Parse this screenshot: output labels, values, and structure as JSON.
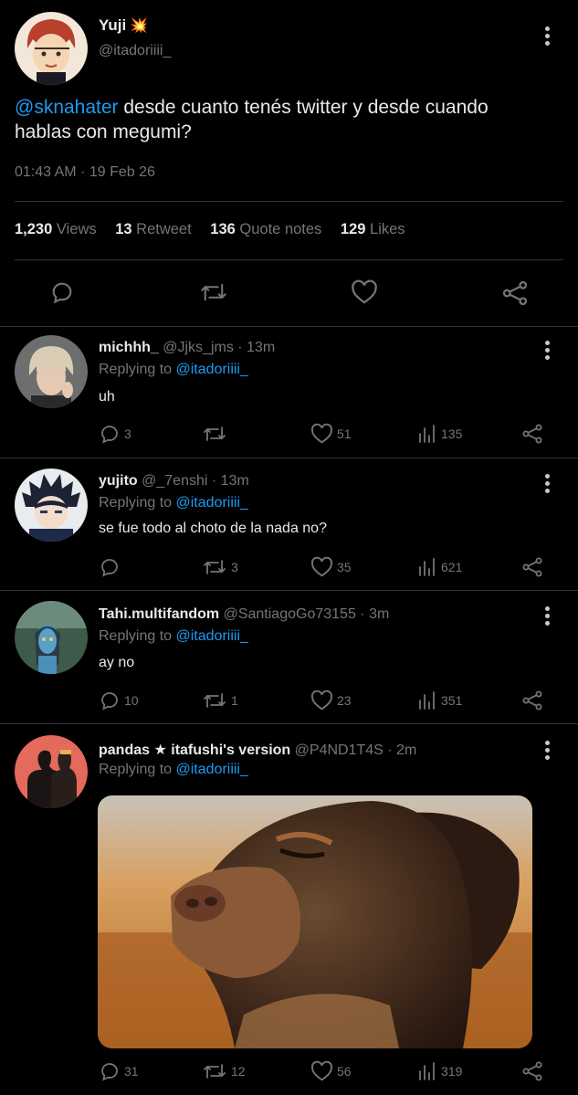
{
  "main_tweet": {
    "name": "Yuji",
    "name_emoji": "💥",
    "handle": "@itadoriiii_",
    "mention": "@sknahater",
    "text": " desde cuanto tenés twitter y desde cuando hablas con megumi?",
    "timestamp": "01:43 AM · 19 Feb 26",
    "stats": {
      "views_count": "1,230",
      "views_label": "Views",
      "retweets_count": "13",
      "retweets_label": "Retweet",
      "quotes_count": "136",
      "quotes_label": "Quote notes",
      "likes_count": "129",
      "likes_label": "Likes"
    },
    "actions": [
      "reply-icon",
      "retweet-icon",
      "heart-icon",
      "share-icon"
    ]
  },
  "replies": [
    {
      "name": "michhh_",
      "handle": "@Jjks_jms",
      "time": "· 13m",
      "replying_prefix": "Replying to",
      "replying_to": "@itadoriiii_",
      "text": "uh",
      "replies": "3",
      "retweets": "",
      "likes": "51",
      "views": "135"
    },
    {
      "name": "yujito",
      "handle": "@_7enshi",
      "time": "· 13m",
      "replying_prefix": "Replying to",
      "replying_to": "@itadoriiii_",
      "text": "se fue todo al choto de la nada no?",
      "replies": "",
      "retweets": "3",
      "likes": "35",
      "views": "621"
    },
    {
      "name": "Tahi.multifandom",
      "handle": "@SantiagoGo73155",
      "time": "· 3m",
      "replying_prefix": "Replying to",
      "replying_to": "@itadoriiii_",
      "text": "ay no",
      "replies": "10",
      "retweets": "1",
      "likes": "23",
      "views": "351"
    },
    {
      "name": "pandas ★ itafushi's version",
      "handle": "@P4ND1T4S",
      "time": "· 2m",
      "replying_prefix": "Replying to",
      "replying_to": "@itadoriiii_",
      "text": "",
      "replies": "31",
      "retweets": "12",
      "likes": "56",
      "views": "319",
      "media": "dog-photo"
    }
  ],
  "colors": {
    "background": "#000000",
    "text": "#e7e9ea",
    "muted": "#71767b",
    "link": "#1d9bf0",
    "divider": "#2f3336"
  }
}
